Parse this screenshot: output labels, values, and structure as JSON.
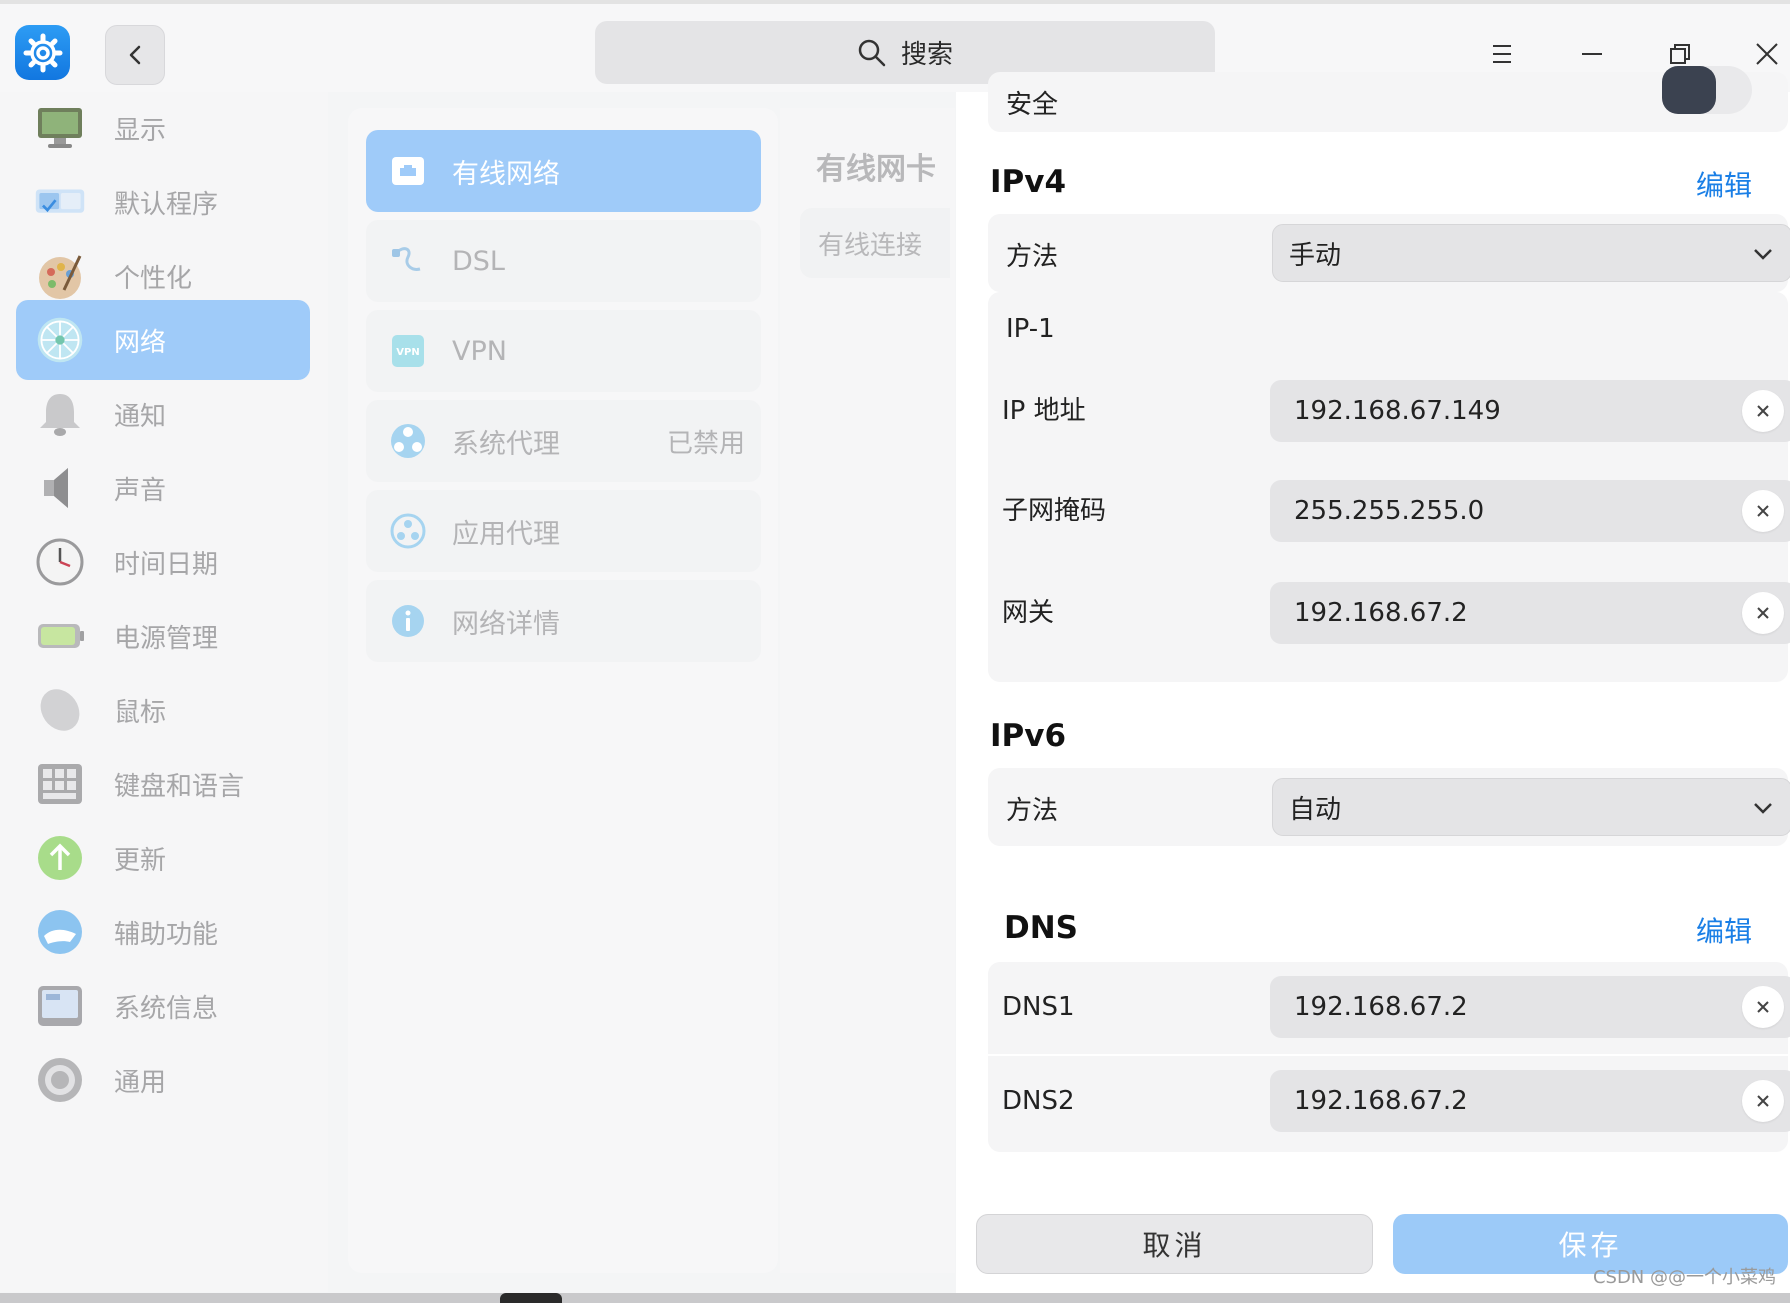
{
  "titlebar": {
    "search_placeholder": "搜索",
    "icons": [
      "control-center-gear-icon",
      "chevron-left-icon",
      "search-icon",
      "hamburger-menu-icon",
      "minimize-icon",
      "restore-icon",
      "close-icon"
    ]
  },
  "sidebar": {
    "items": [
      {
        "label": "显示",
        "icon": "display-icon"
      },
      {
        "label": "默认程序",
        "icon": "default-apps-icon"
      },
      {
        "label": "个性化",
        "icon": "palette-icon"
      },
      {
        "label": "网络",
        "icon": "network-icon",
        "active": true
      },
      {
        "label": "通知",
        "icon": "bell-icon"
      },
      {
        "label": "声音",
        "icon": "speaker-icon"
      },
      {
        "label": "时间日期",
        "icon": "clock-icon"
      },
      {
        "label": "电源管理",
        "icon": "battery-icon"
      },
      {
        "label": "鼠标",
        "icon": "mouse-icon"
      },
      {
        "label": "键盘和语言",
        "icon": "keyboard-icon"
      },
      {
        "label": "更新",
        "icon": "update-arrow-icon"
      },
      {
        "label": "辅助功能",
        "icon": "accessibility-hand-icon"
      },
      {
        "label": "系统信息",
        "icon": "system-info-icon"
      },
      {
        "label": "通用",
        "icon": "general-settings-icon"
      }
    ]
  },
  "network_menu": {
    "items": [
      {
        "label": "有线网络",
        "icon": "ethernet-icon",
        "active": true
      },
      {
        "label": "DSL",
        "icon": "dsl-cable-icon"
      },
      {
        "label": "VPN",
        "icon": "vpn-icon"
      },
      {
        "label": "系统代理",
        "icon": "system-proxy-icon",
        "status": "已禁用"
      },
      {
        "label": "应用代理",
        "icon": "app-proxy-icon"
      },
      {
        "label": "网络详情",
        "icon": "info-icon"
      }
    ]
  },
  "adapter_column": {
    "title": "有线网卡",
    "connection": "有线连接"
  },
  "settings": {
    "security_label": "安全",
    "ipv4": {
      "title": "IPv4",
      "edit": "编辑",
      "method_label": "方法",
      "method_value": "手动",
      "ip_group_label": "IP-1",
      "ip_label": "IP 地址",
      "ip_value": "192.168.67.149",
      "mask_label": "子网掩码",
      "mask_value": "255.255.255.0",
      "gateway_label": "网关",
      "gateway_value": "192.168.67.2"
    },
    "ipv6": {
      "title": "IPv6",
      "method_label": "方法",
      "method_value": "自动"
    },
    "dns": {
      "title": "DNS",
      "edit": "编辑",
      "dns1_label": "DNS1",
      "dns1_value": "192.168.67.2",
      "dns2_label": "DNS2",
      "dns2_value": "192.168.67.2"
    }
  },
  "actions": {
    "cancel": "取消",
    "save": "保存"
  },
  "watermark": "CSDN @@一个小菜鸡",
  "colors": {
    "accent": "#1a7fe6",
    "selected_item": "#9fcbf9",
    "save_button": "#9ccaf8",
    "toggle_knob": "#3b4250"
  }
}
